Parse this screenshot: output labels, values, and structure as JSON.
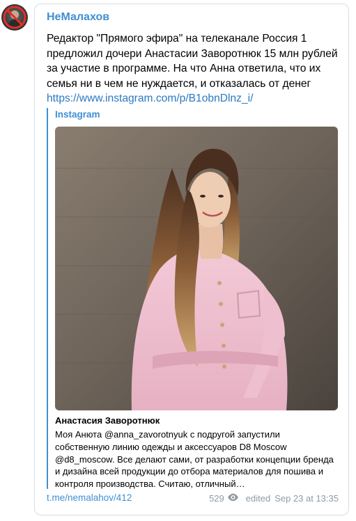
{
  "channel": {
    "name": "НеМалахов"
  },
  "post": {
    "text": "Редактор \"Прямого эфира\" на телеканале Россия 1 предложил дочери Анастасии Заворотнюк 15 млн рублей за участие в программе. На что Анна ответила, что их семья ни в чем не нуждается, и отказалась от денег ",
    "link": "https://www.instagram.com/p/B1obnDlnz_i/"
  },
  "preview": {
    "site_name": "Instagram",
    "author": "Анастасия Заворотнюк",
    "description": "Моя Анюта @anna_zavorotnyuk с подругой запустили собственную линию одежды и аксессуаров D8 Moscow @d8_moscow. Все делают сами, от разработки концепции бренда и дизайна всей продукции до отбора материалов для пошива и контроля производства. Считаю, отличный…"
  },
  "footer": {
    "post_link": "t.me/nemalahov/412",
    "views": "529",
    "edited": "edited",
    "timestamp": "Sep 23 at 13:35"
  },
  "icons": {
    "views": "eye-icon",
    "avatar": "channel-avatar"
  },
  "colors": {
    "accent": "#3f8fd2",
    "link": "#2a79c0",
    "meta": "#8f9aa5"
  }
}
